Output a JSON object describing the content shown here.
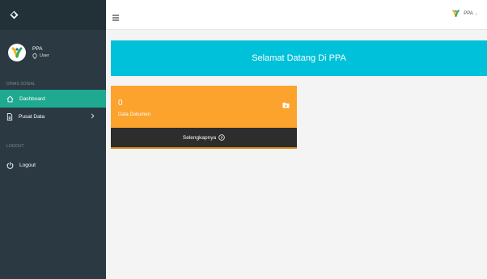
{
  "sidebar": {
    "user": {
      "name": "PPA",
      "role": "User"
    },
    "section_main": "DINAS SOSIAL",
    "items": [
      {
        "label": "Dashboard",
        "icon": "home-icon",
        "active": true
      },
      {
        "label": "Pusat Data",
        "icon": "document-icon",
        "active": false
      }
    ],
    "section_logout": "LOGOUT",
    "logout_label": "Logout"
  },
  "topbar": {
    "user_name": "PPA",
    "caret": "⌄"
  },
  "welcome": "Selamat Datang Di PPA",
  "card": {
    "count": "0",
    "label": "Data Dokumen",
    "footer": "Selengkapnya",
    "color": "#fba32c"
  },
  "colors": {
    "sidebar": "#2b3942",
    "active": "#1fa990",
    "banner": "#00c1da",
    "card": "#fba32c",
    "card_footer": "#2d2d2d"
  }
}
